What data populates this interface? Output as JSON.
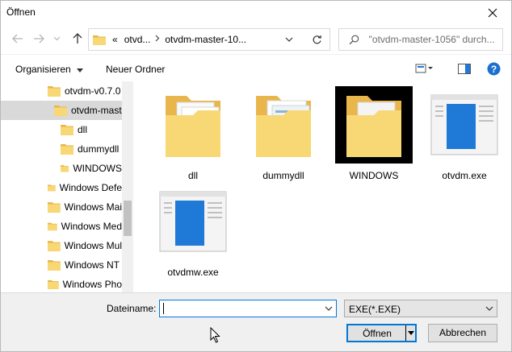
{
  "window": {
    "title": "Öffnen"
  },
  "address": {
    "prefix": "«",
    "crumbs": [
      "otvd...",
      "otvdm-master-10..."
    ]
  },
  "search": {
    "placeholder": "\"otvdm-master-1056\" durch..."
  },
  "toolbar": {
    "organize": "Organisieren",
    "new_folder": "Neuer Ordner"
  },
  "sidebar": {
    "items": [
      {
        "label": "otvdm-v0.7.0",
        "selected": false
      },
      {
        "label": "otvdm-mast",
        "selected": true
      },
      {
        "label": "dll",
        "selected": false
      },
      {
        "label": "dummydll",
        "selected": false
      },
      {
        "label": "WINDOWS",
        "selected": false
      },
      {
        "label": "Windows Defe",
        "selected": false
      },
      {
        "label": "Windows Mai",
        "selected": false
      },
      {
        "label": "Windows Med",
        "selected": false
      },
      {
        "label": "Windows Mul",
        "selected": false
      },
      {
        "label": "Windows NT",
        "selected": false
      },
      {
        "label": "Windows Pho",
        "selected": false
      }
    ]
  },
  "files": [
    {
      "name": "dll",
      "kind": "folder"
    },
    {
      "name": "dummydll",
      "kind": "folder"
    },
    {
      "name": "WINDOWS",
      "kind": "folder"
    },
    {
      "name": "otvdm.exe",
      "kind": "exe"
    },
    {
      "name": "otvdmw.exe",
      "kind": "exe"
    }
  ],
  "footer": {
    "filename_label": "Dateiname:",
    "filename_value": "",
    "filetype": "EXE(*.EXE)",
    "open_label": "Öffnen",
    "cancel_label": "Abbrechen"
  },
  "colors": {
    "accent": "#0078d7",
    "folder": "#f8d775",
    "folder_dark": "#e8b64a",
    "exe_blue": "#1e7ad6",
    "selected": "#d9d9d9"
  }
}
